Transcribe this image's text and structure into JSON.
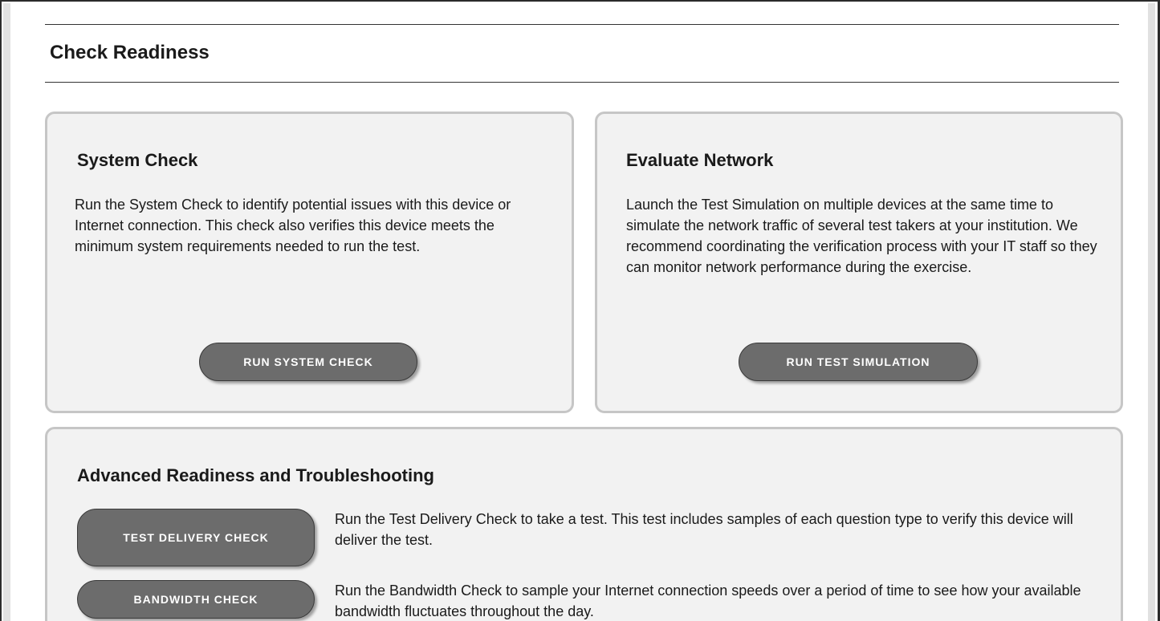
{
  "page": {
    "title": "Check Readiness"
  },
  "system_check": {
    "title": "System Check",
    "description": "Run the System Check to identify potential issues with this device or Internet connection. This check also verifies this device meets the minimum system requirements needed to run the test.",
    "button_label": "RUN SYSTEM CHECK"
  },
  "evaluate_network": {
    "title": "Evaluate Network",
    "description": "Launch the Test Simulation on multiple devices at the same time to simulate the network traffic of several test takers at your institution. We recommend coordinating the verification process with your IT staff so they can monitor network performance during the exercise.",
    "button_label": "RUN TEST SIMULATION"
  },
  "advanced": {
    "title": "Advanced Readiness and Troubleshooting",
    "items": [
      {
        "button_label": "TEST DELIVERY CHECK",
        "description": "Run the Test Delivery Check to take a test. This test includes samples of each question type to verify this device will deliver the test."
      },
      {
        "button_label": "BANDWIDTH CHECK",
        "description": "Run the Bandwidth Check to sample your Internet connection speeds over a period of time to see how your available bandwidth fluctuates throughout the day."
      }
    ]
  },
  "colors": {
    "card_background": "#f2f2f2",
    "card_border": "#c6c6c6",
    "button_background": "#6c6c6c",
    "button_text": "#ffffff"
  }
}
